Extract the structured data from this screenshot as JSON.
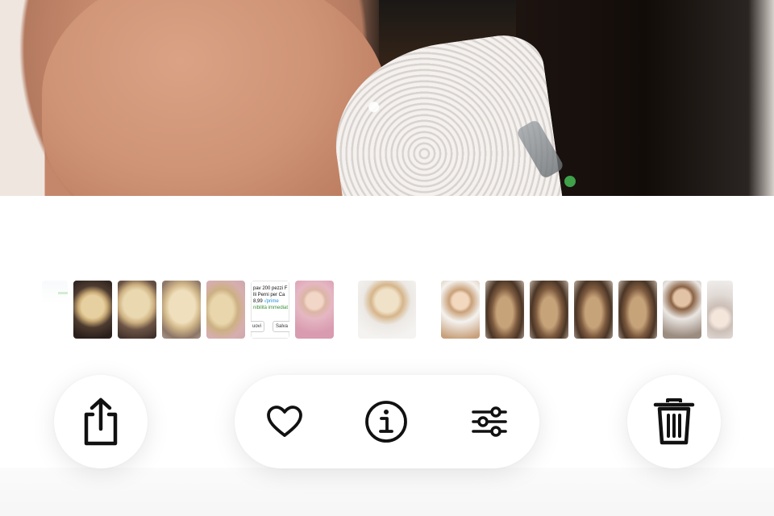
{
  "photo_viewer": {
    "toolbar": {
      "share": {
        "icon": "share-icon"
      },
      "favorite": {
        "icon": "heart-icon"
      },
      "info": {
        "icon": "info-icon"
      },
      "adjust": {
        "icon": "sliders-icon"
      },
      "delete": {
        "icon": "trash-icon"
      }
    },
    "thumbnails": [
      {
        "type": "screenshot"
      },
      {
        "type": "photo",
        "subject": "hair-bun"
      },
      {
        "type": "photo",
        "subject": "hair-updo"
      },
      {
        "type": "photo",
        "subject": "hair-updo"
      },
      {
        "type": "photo",
        "subject": "hair-updo"
      },
      {
        "type": "screenshot",
        "lines": [
          "pav 200 pezzi F",
          "lli Perni per Ca"
        ],
        "price": "8,99",
        "prime": "√prime",
        "availability": "nibilità immediat",
        "buttons": [
          "uovi",
          "Salva"
        ]
      },
      {
        "type": "photo",
        "subject": "baby"
      },
      {
        "type": "photo",
        "subject": "bride-veil",
        "selected": true
      },
      {
        "type": "photo",
        "subject": "woman"
      },
      {
        "type": "photo",
        "subject": "braid"
      },
      {
        "type": "photo",
        "subject": "braid"
      },
      {
        "type": "photo",
        "subject": "braid"
      },
      {
        "type": "photo",
        "subject": "braid"
      },
      {
        "type": "photo",
        "subject": "woman"
      },
      {
        "type": "photo",
        "subject": "woman"
      }
    ]
  },
  "colors": {
    "background": "#ffffff",
    "icon": "#111111",
    "button_bg": "#ffffff"
  }
}
